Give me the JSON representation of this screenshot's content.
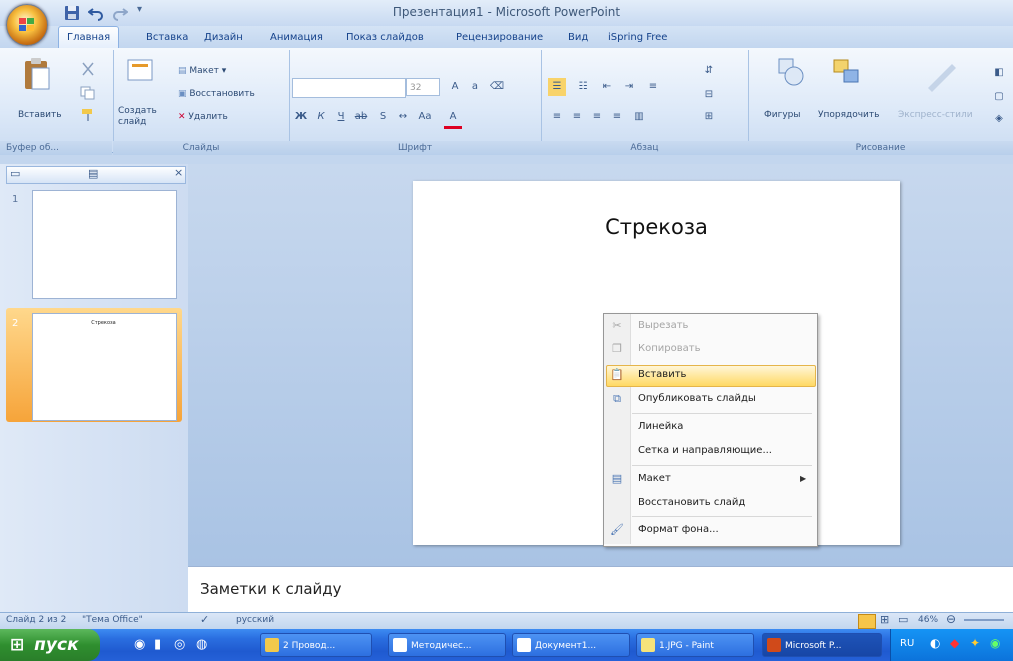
{
  "window": {
    "title": "Презентация1 - Microsoft PowerPoint"
  },
  "tabs": [
    "Главная",
    "Вставка",
    "Дизайн",
    "Анимация",
    "Показ слайдов",
    "Рецензирование",
    "Вид",
    "iSpring Free"
  ],
  "ribbon": {
    "clipboard": {
      "paste": "Вставить",
      "label": "Буфер об..."
    },
    "slides": {
      "new_slide": "Создать слайд",
      "layout": "Макет",
      "reset": "Восстановить",
      "delete": "Удалить",
      "label": "Слайды"
    },
    "font": {
      "size": "32",
      "label": "Шрифт"
    },
    "paragraph": {
      "label": "Абзац"
    },
    "drawing": {
      "shapes": "Фигуры",
      "arrange": "Упорядочить",
      "quick_styles": "Экспресс-стили",
      "label": "Рисование"
    }
  },
  "slides_panel": {
    "thumbs": [
      {
        "num": "1",
        "text": ""
      },
      {
        "num": "2",
        "text": "Стрекоза"
      }
    ]
  },
  "slide": {
    "title": "Стрекоза"
  },
  "context_menu": [
    {
      "label": "Вырезать",
      "icon": "scissors-icon",
      "disabled": true
    },
    {
      "label": "Копировать",
      "icon": "copy-icon",
      "disabled": true
    },
    {
      "label": "Вставить",
      "icon": "paste-icon",
      "highlighted": true
    },
    {
      "label": "Опубликовать слайды",
      "icon": "publish-icon"
    },
    {
      "label": "Линейка",
      "icon": ""
    },
    {
      "label": "Сетка и направляющие...",
      "icon": ""
    },
    {
      "label": "Макет",
      "icon": "layout-icon",
      "submenu": true
    },
    {
      "label": "Восстановить слайд",
      "icon": ""
    },
    {
      "label": "Формат фона...",
      "icon": "format-background-icon"
    }
  ],
  "notes": {
    "placeholder": "Заметки к слайду"
  },
  "status": {
    "slide": "Слайд 2 из 2",
    "theme": "\"Тема Office\"",
    "language": "русский",
    "zoom": "46%"
  },
  "taskbar": {
    "start": "пуск",
    "tasks": [
      "2 Провод...",
      "Методичес...",
      "Документ1...",
      "1.JPG - Paint",
      "Microsoft P..."
    ],
    "tray_lang": "RU"
  }
}
